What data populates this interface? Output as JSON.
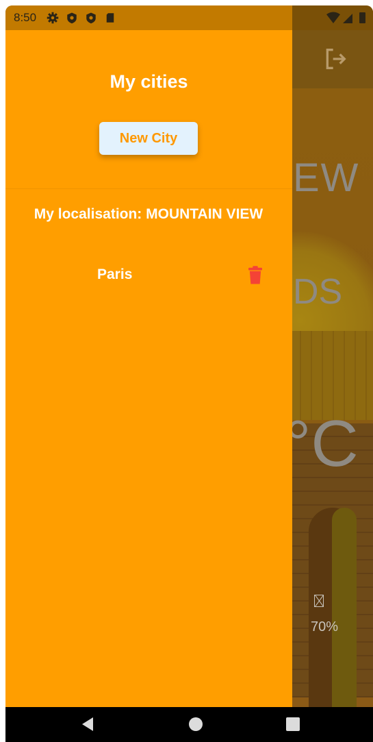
{
  "status_bar": {
    "time": "8:50",
    "icons": [
      "gear-icon",
      "shield-icon",
      "shield-icon",
      "sd-card-icon"
    ],
    "right_icons": [
      "wifi-icon",
      "signal-icon",
      "battery-icon"
    ]
  },
  "background": {
    "city_partial": "EW",
    "description_partial": "DS",
    "temperature_partial": "°C",
    "humidity_value": "70%",
    "logout_icon": "logout-icon"
  },
  "drawer": {
    "title": "My cities",
    "new_city_button": "New City",
    "my_location": "My localisation: MOUNTAIN VIEW",
    "cities": [
      {
        "name": "Paris",
        "delete_icon": "trash-icon"
      }
    ]
  },
  "nav_bar": {
    "icons": [
      "back-icon",
      "home-icon",
      "recents-icon"
    ]
  },
  "colors": {
    "drawer": "#ff9e00",
    "button_bg": "#e3f2fd",
    "button_text": "#ff9800",
    "delete": "#f44336",
    "status_bar": "#c27a00"
  }
}
